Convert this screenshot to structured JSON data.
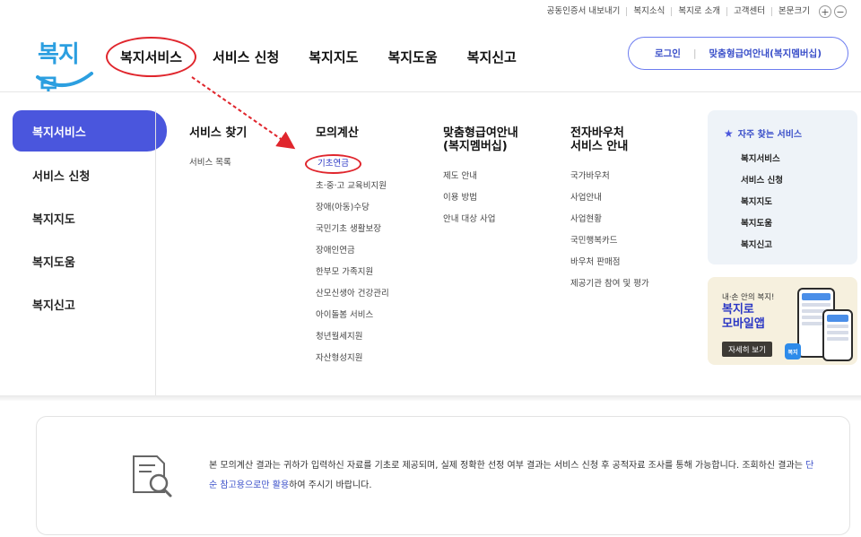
{
  "utility_links": [
    "공동인증서 내보내기",
    "복지소식",
    "복지로 소개",
    "고객센터",
    "본문크기"
  ],
  "zoom": {
    "plus": "+",
    "minus": "−"
  },
  "logo_text": "복지로",
  "gnb": [
    "복지서비스",
    "서비스 신청",
    "복지지도",
    "복지도움",
    "복지신고"
  ],
  "header_right": {
    "login": "로그인",
    "custom": "맞춤형급여안내(복지멤버십)"
  },
  "left_nav": [
    "복지서비스",
    "서비스 신청",
    "복지지도",
    "복지도움",
    "복지신고"
  ],
  "columns": [
    {
      "title": "서비스 찾기",
      "items": [
        "서비스 목록"
      ]
    },
    {
      "title": "모의계산",
      "items": [
        "기초연금",
        "초·중·고 교육비지원",
        "장애(아동)수당",
        "국민기초 생활보장",
        "장애인연금",
        "한부모 가족지원",
        "산모신생아 건강관리",
        "아이돌봄 서비스",
        "청년월세지원",
        "자산형성지원"
      ]
    },
    {
      "title_line1": "맞춤형급여안내",
      "title_line2": "(복지멤버십)",
      "items": [
        "제도 안내",
        "이용 방법",
        "안내 대상 사업"
      ]
    },
    {
      "title_line1": "전자바우처",
      "title_line2": "서비스 안내",
      "items": [
        "국가바우처",
        "사업안내",
        "사업현황",
        "국민행복카드",
        "바우처 판매점",
        "제공기관 참여 및 평가"
      ]
    }
  ],
  "quick": {
    "title": "자주 찾는 서비스",
    "items": [
      "복지서비스",
      "서비스 신청",
      "복지지도",
      "복지도움",
      "복지신고"
    ]
  },
  "app_banner": {
    "small": "내·손 안의 복지!",
    "big_line1": "복지로",
    "big_line2": "모바일앱",
    "button": "자세히 보기",
    "badge": "복지"
  },
  "notice": {
    "part1": "본 모의계산 결과는 귀하가 입력하신 자료를 기초로 제공되며, 실제 정확한 선정 여부 결과는 서비스 신청 후 공적자료 조사를 통해 가능합니다. 조회하신 결과는 ",
    "emph": "단순 참고용으로만 활용",
    "part2": "하여 주시기 바랍니다."
  },
  "colors": {
    "accent": "#4a56dd",
    "highlight": "#e0262d",
    "brand": "#2c9fe0"
  }
}
